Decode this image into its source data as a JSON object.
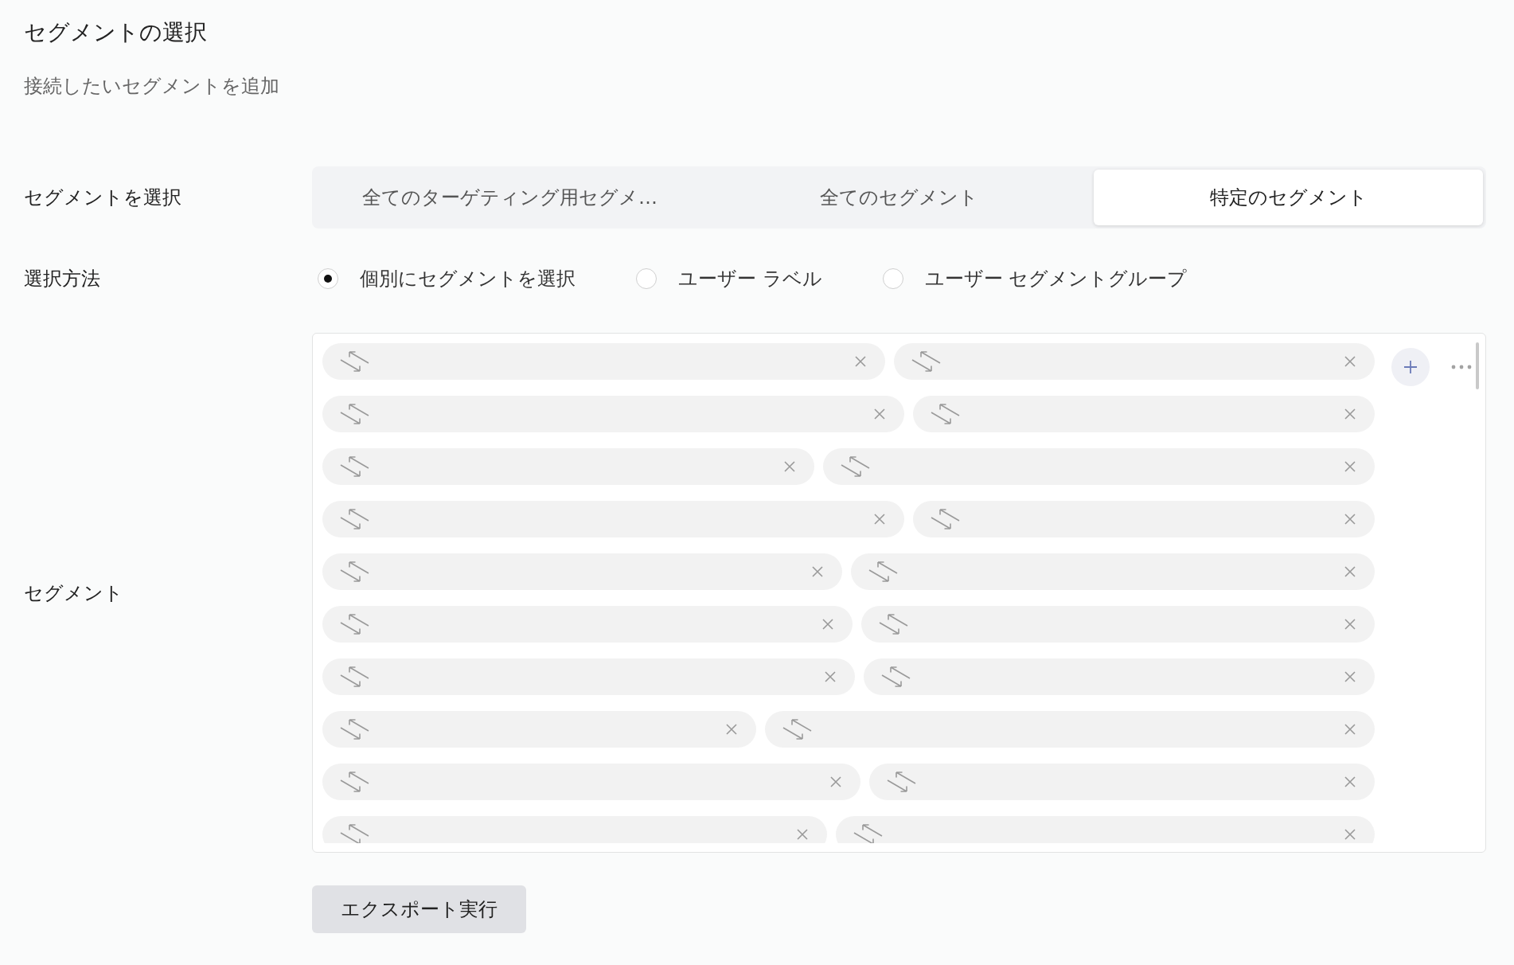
{
  "header": {
    "title": "セグメントの選択",
    "subtitle": "接続したいセグメントを追加"
  },
  "segment_select": {
    "label": "セグメントを選択",
    "tabs": [
      {
        "label": "全てのターゲティング用セグメ…",
        "selected": false
      },
      {
        "label": "全てのセグメント",
        "selected": false
      },
      {
        "label": "特定のセグメント",
        "selected": true
      }
    ]
  },
  "selection_method": {
    "label": "選択方法",
    "options": [
      {
        "label": "個別にセグメントを選択",
        "selected": true
      },
      {
        "label": "ユーザー ラベル",
        "selected": false
      },
      {
        "label": "ユーザー セグメントグループ",
        "selected": false
      }
    ]
  },
  "segments": {
    "label": "セグメント",
    "tags": [
      {
        "removable": true
      },
      {
        "removable": true
      },
      {
        "removable": true
      },
      {
        "removable": true
      },
      {
        "removable": true
      },
      {
        "removable": true
      },
      {
        "removable": true
      },
      {
        "removable": true
      },
      {
        "removable": true
      },
      {
        "removable": true
      },
      {
        "removable": true
      },
      {
        "removable": true
      },
      {
        "removable": true
      },
      {
        "removable": true
      },
      {
        "removable": true
      },
      {
        "removable": true
      },
      {
        "removable": true
      },
      {
        "removable": true
      },
      {
        "removable": true
      },
      {
        "removable": true
      }
    ]
  },
  "export_button": {
    "label": "エクスポート実行"
  }
}
